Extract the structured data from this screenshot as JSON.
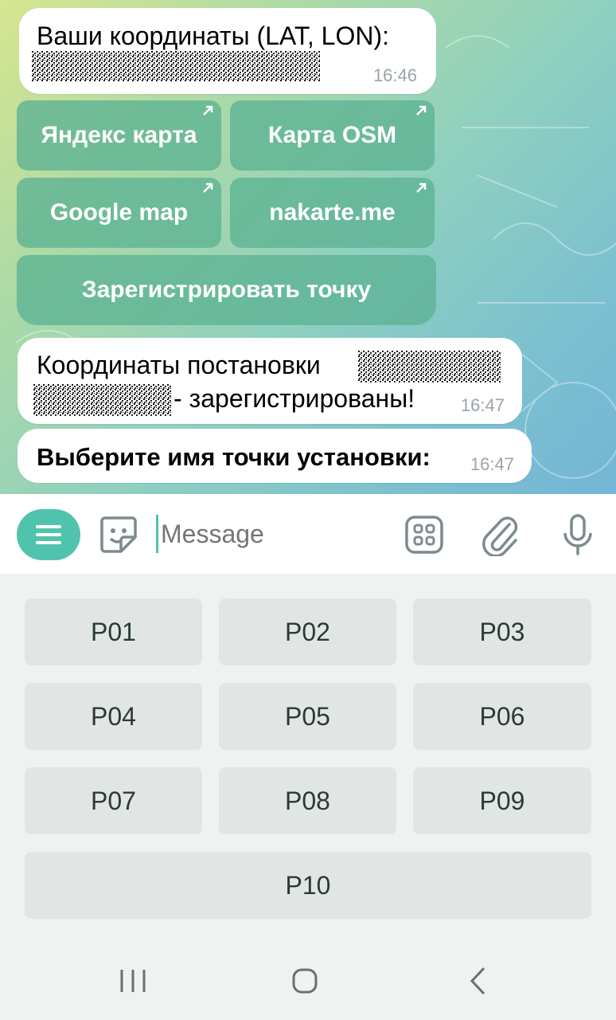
{
  "messages": [
    {
      "text_line1": "Ваши координаты (LAT, LON):",
      "time": "16:46"
    },
    {
      "text_line1": "Координаты постановки",
      "text_line2": "- зарегистрированы!",
      "time": "16:47"
    },
    {
      "text_line1": "Выберите имя точки установки:",
      "time": "16:47"
    }
  ],
  "inline_buttons": [
    {
      "label": "Яндекс карта",
      "external": true
    },
    {
      "label": "Карта OSM",
      "external": true
    },
    {
      "label": "Google map",
      "external": true
    },
    {
      "label": "nakarte.me",
      "external": true
    },
    {
      "label": "Зарегистрировать точку",
      "external": false
    }
  ],
  "input": {
    "placeholder": "Message"
  },
  "icons": {
    "menu": "menu-icon",
    "sticker": "sticker-icon",
    "commands": "grid-icon",
    "attach": "paperclip-icon",
    "voice": "microphone-icon",
    "external": "external-link-icon"
  },
  "keyboard": [
    "P01",
    "P02",
    "P03",
    "P04",
    "P05",
    "P06",
    "P07",
    "P08",
    "P09",
    "P10"
  ],
  "navbar": {
    "recent": "recent-apps-icon",
    "home": "home-icon",
    "back": "back-icon"
  },
  "colors": {
    "accent": "#4fc3ad",
    "inline_button": "#5cb294"
  }
}
